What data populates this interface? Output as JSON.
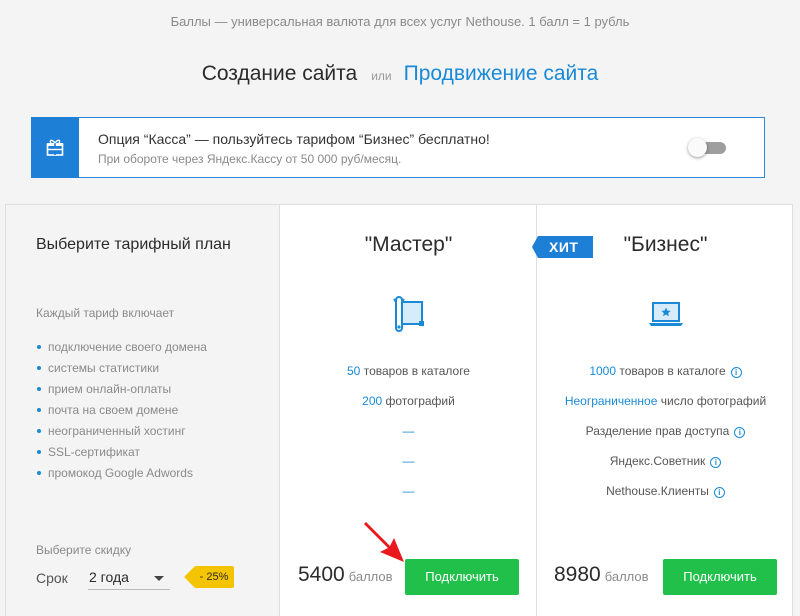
{
  "top_notice": "Баллы — универсальная валюта для всех услуг Nethouse. 1 балл = 1 рубль",
  "tabs": {
    "active": "Создание сайта",
    "separator": "или",
    "link": "Продвижение сайта"
  },
  "banner": {
    "icon": "gift-icon",
    "title": "Опция “Касса” — пользуйтесь тарифом “Бизнес” бесплатно!",
    "subtitle": "При обороте через Яндекс.Кассу от 50 000 руб/месяц.",
    "toggle_on": false
  },
  "left": {
    "title": "Выберите тарифный план",
    "includes_label": "Каждый тариф включает",
    "features": [
      "подключение своего домена",
      "системы статистики",
      "прием онлайн-оплаты",
      "почта на своем домене",
      "неограниченный хостинг",
      "SSL-сертификат",
      "промокод Google Adwords"
    ],
    "discount_label": "Выберите скидку",
    "term_label": "Срок",
    "term_value": "2 года",
    "discount_badge": "- 25%"
  },
  "master": {
    "name": "\"Мастер\"",
    "icon": "wrench-frame-icon",
    "products_num": "50",
    "products_text": "товаров в каталоге",
    "photos_num": "200",
    "photos_text": "фотографий",
    "dash": "—",
    "price": "5400",
    "unit": "баллов",
    "button": "Подключить"
  },
  "business": {
    "badge": "ХИТ",
    "name": "\"Бизнес\"",
    "icon": "laptop-star-icon",
    "products_num": "1000",
    "products_text": "товаров в каталоге",
    "photos_hl": "Неограниченное",
    "photos_text": "число фотографий",
    "access": "Разделение прав доступа",
    "advisor": "Яндекс.Советник",
    "clients": "Nethouse.Клиенты",
    "info_glyph": "i",
    "price": "8980",
    "unit": "баллов",
    "button": "Подключить"
  },
  "colors": {
    "accent_blue": "#1a8ad6",
    "button_green": "#21c04b",
    "badge_yellow": "#f5c400",
    "arrow_red": "#e8181c"
  }
}
